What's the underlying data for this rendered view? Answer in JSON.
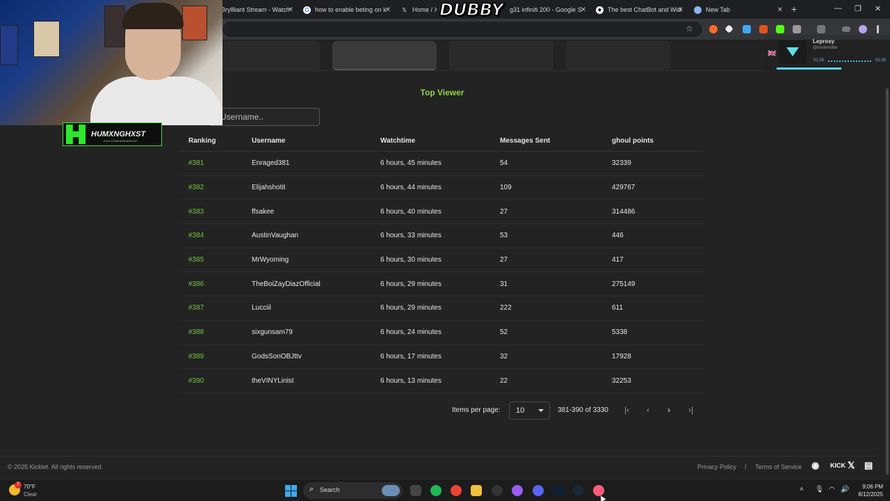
{
  "browser": {
    "tabs": [
      {
        "title": "Bryllliant Stream - Watch",
        "favicon": "kick-icon",
        "color": "#53fc18"
      },
      {
        "title": "how to enable beting on k",
        "favicon": "google-icon",
        "color": "#4285f4"
      },
      {
        "title": "Home / X",
        "favicon": "x-icon",
        "color": "#000000"
      },
      {
        "title": "g31 infiniti 200 - Google S",
        "favicon": "google-icon",
        "color": "#4285f4"
      },
      {
        "title": "The best ChatBot and Wid",
        "favicon": "botrix-icon",
        "color": "#ffffff"
      },
      {
        "title": "New Tab",
        "favicon": "chrome-icon",
        "color": "#8ab4f8"
      }
    ],
    "overlay_logo": "DUBBY"
  },
  "header": {
    "title": "Top Viewer"
  },
  "search": {
    "placeholder": "Username.."
  },
  "table": {
    "columns": [
      "Ranking",
      "Username",
      "Watchtime",
      "Messages Sent",
      "ghoul points"
    ],
    "rows": [
      [
        "#381",
        "Enraged381",
        "6 hours, 45 minutes",
        "54",
        "32339"
      ],
      [
        "#382",
        "Elijahshotit",
        "6 hours, 44 minutes",
        "109",
        "429767"
      ],
      [
        "#383",
        "ffsakee",
        "6 hours, 40 minutes",
        "27",
        "314486"
      ],
      [
        "#384",
        "AustinVaughan",
        "6 hours, 33 minutes",
        "53",
        "446"
      ],
      [
        "#385",
        "MrWyoming",
        "6 hours, 30 minutes",
        "27",
        "417"
      ],
      [
        "#386",
        "TheBoiZayDiazOfficial",
        "6 hours, 29 minutes",
        "31",
        "275149"
      ],
      [
        "#387",
        "Lucciil",
        "6 hours, 29 minutes",
        "222",
        "611"
      ],
      [
        "#388",
        "sixgunsam79",
        "6 hours, 24 minutes",
        "52",
        "5338"
      ],
      [
        "#389",
        "GodsSonOBJttv",
        "6 hours, 17 minutes",
        "32",
        "17928"
      ],
      [
        "#390",
        "theVINYLinist",
        "6 hours, 13 minutes",
        "22",
        "32253"
      ]
    ]
  },
  "pagination": {
    "items_label": "Items per page:",
    "per_page": "10",
    "range": "381-390 of 3330"
  },
  "footer": {
    "copyright": "© 2025 Kicklet. All rights reserved.",
    "privacy": "Privacy Policy",
    "separator": "|",
    "terms": "Terms of Service",
    "kick_label": "KICK"
  },
  "overlays": {
    "streamer_name": "HUMXNGHXST",
    "streamer_sub": "KICK.COM/HUMXNGHXST",
    "now_playing_title": "Leprosy",
    "now_playing_artist": "@hostemdite",
    "now_playing_elapsed": "01:28",
    "now_playing_total": "02:28",
    "now_playing_progress": 0.6
  },
  "taskbar": {
    "weather_badge": "7",
    "temperature": "70°F",
    "condition": "Clear",
    "search_label": "Search",
    "time": "9:06 PM",
    "date": "8/12/2025"
  },
  "colors": {
    "accent": "#74c23e",
    "background": "#232323"
  }
}
